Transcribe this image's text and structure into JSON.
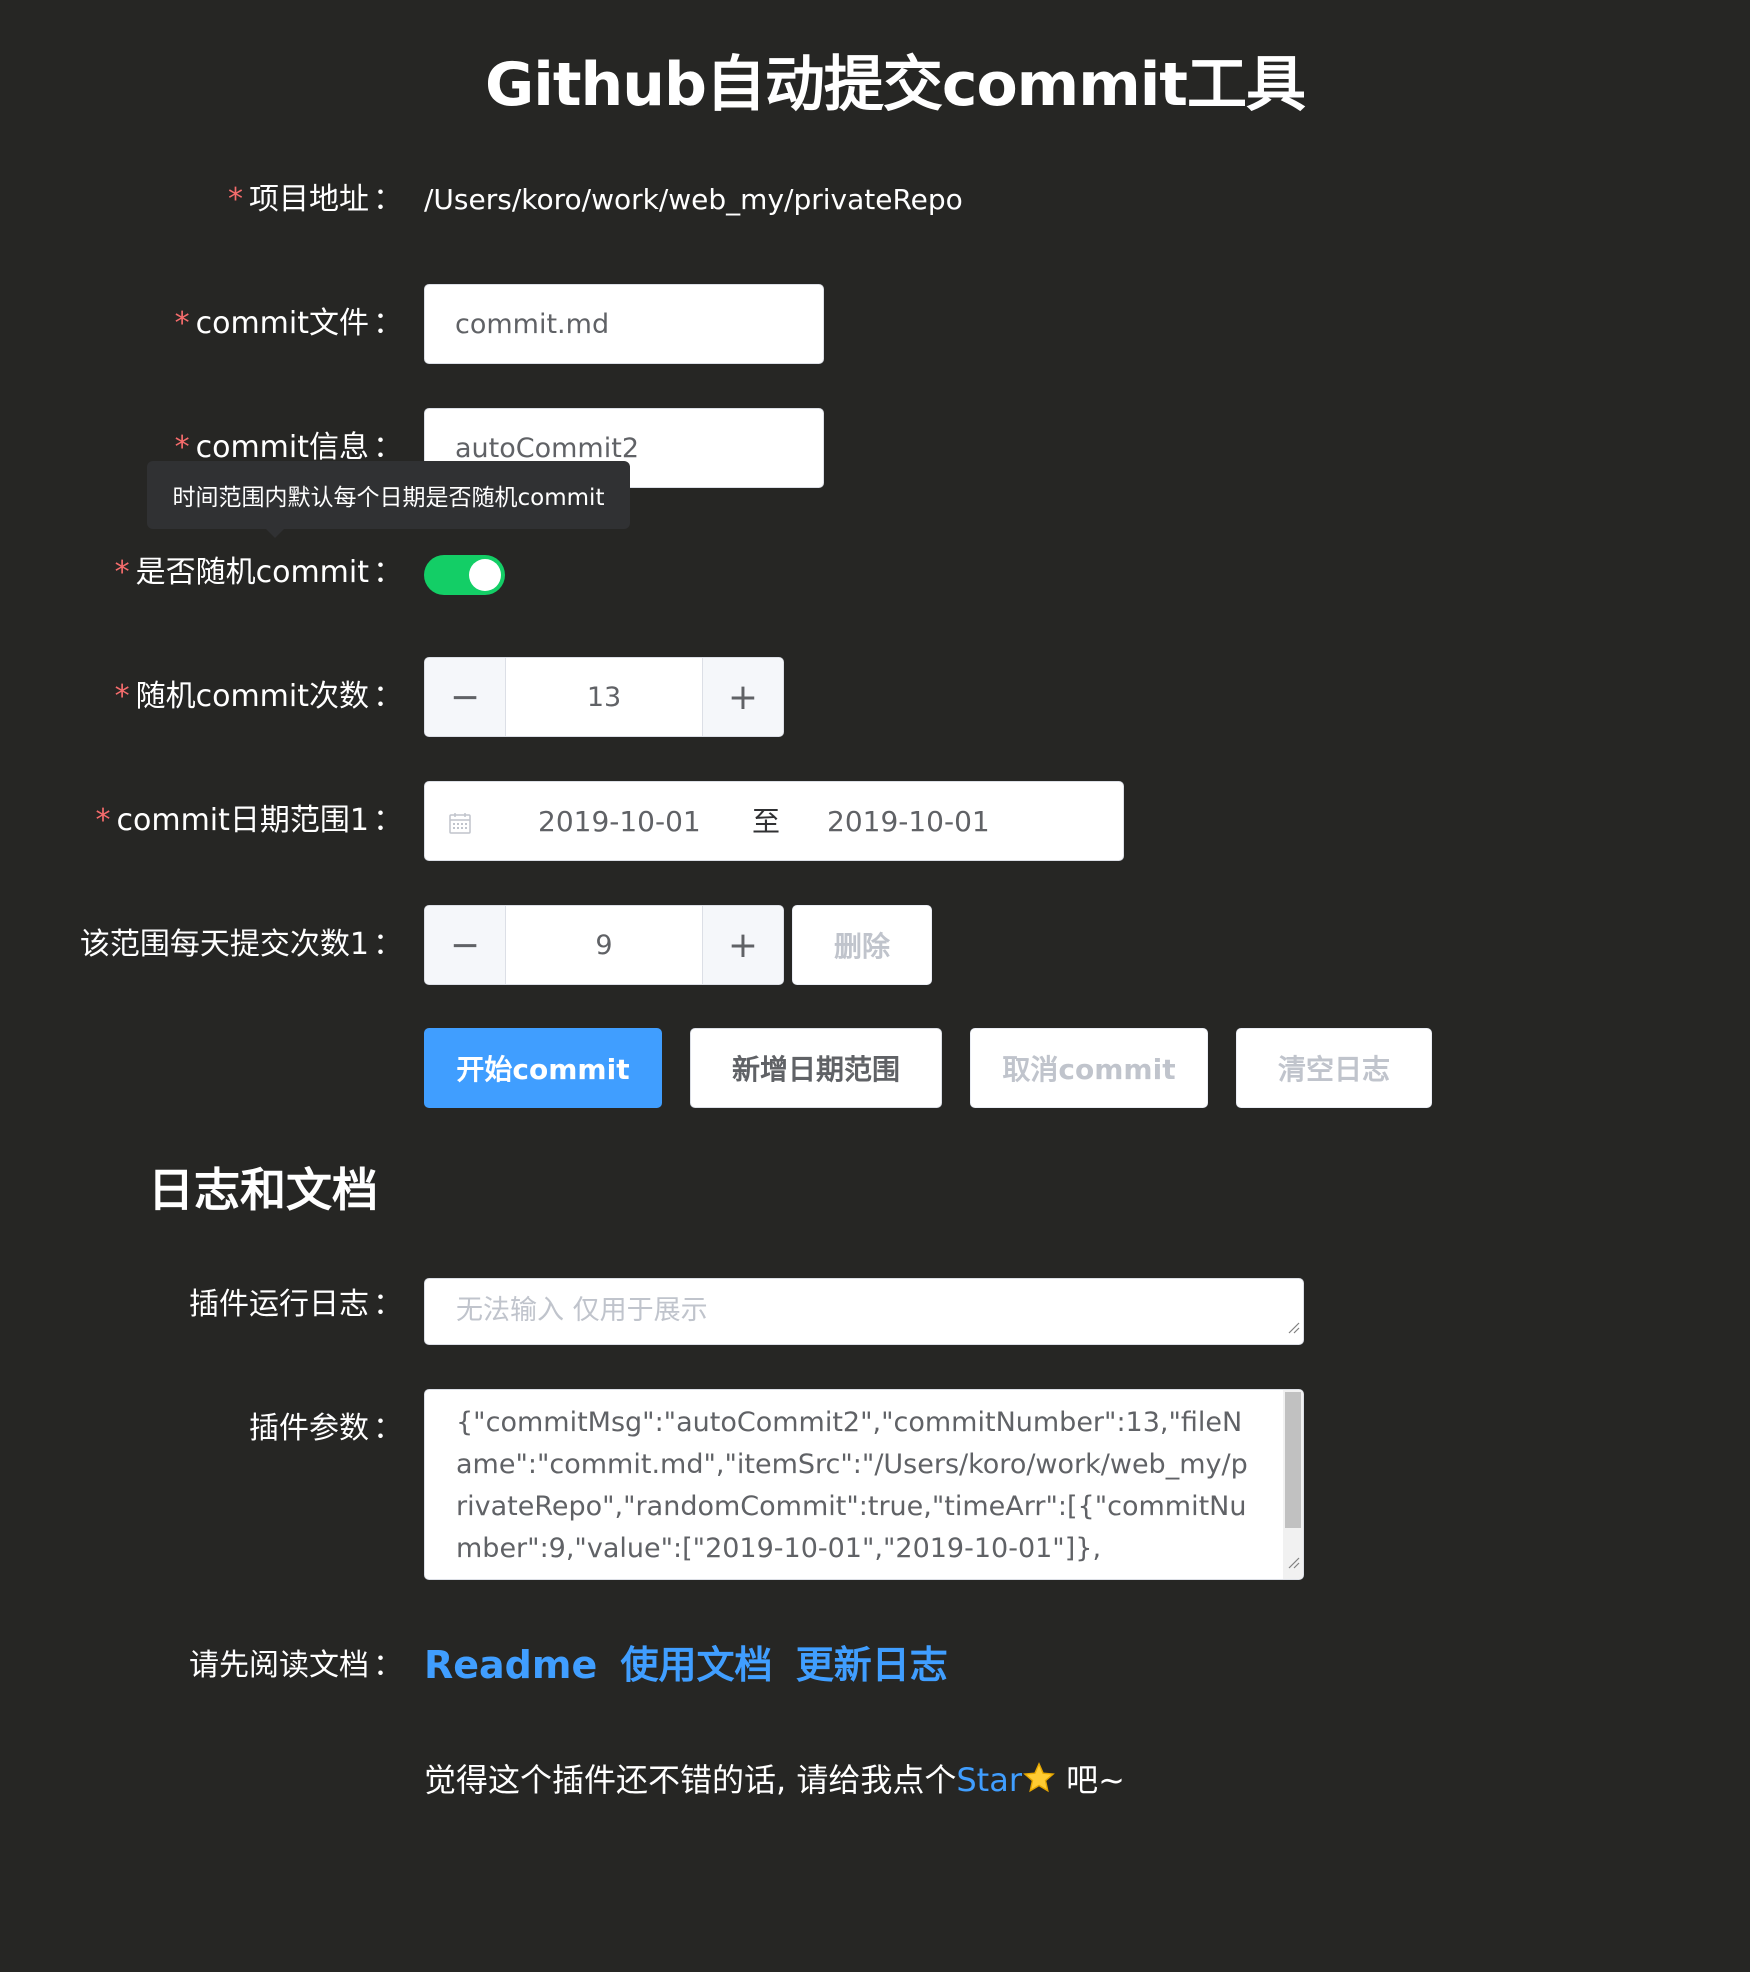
{
  "title": "Github自动提交commit工具",
  "form": {
    "item_src": {
      "label": "项目地址",
      "value": "/Users/koro/work/web_my/privateRepo"
    },
    "file_name": {
      "label": "commit文件",
      "value": "commit.md"
    },
    "commit_msg": {
      "label": "commit信息",
      "value": "autoCommit2"
    },
    "random_commit": {
      "label": "是否随机commit",
      "on": true,
      "tooltip": "时间范围内默认每个日期是否随机commit"
    },
    "random_count": {
      "label": "随机commit次数",
      "value": "13",
      "minus": "−",
      "plus": "+"
    },
    "date_range": {
      "label": "commit日期范围1",
      "start": "2019-10-01",
      "separator": "至",
      "end": "2019-10-01",
      "icon": "calendar-icon"
    },
    "daily_count": {
      "label": "该范围每天提交次数1",
      "value": "9",
      "minus": "−",
      "plus": "+",
      "delete_label": "删除"
    },
    "colon": "：",
    "required_mark": "*"
  },
  "actions": {
    "start": "开始commit",
    "add_range": "新增日期范围",
    "cancel": "取消commit",
    "clear_log": "清空日志"
  },
  "docs_section": {
    "title": "日志和文档",
    "log": {
      "label": "插件运行日志",
      "placeholder": "无法输入 仅用于展示"
    },
    "params": {
      "label": "插件参数",
      "value": "{\"commitMsg\":\"autoCommit2\",\"commitNumber\":13,\"fileName\":\"commit.md\",\"itemSrc\":\"/Users/koro/work/web_my/privateRepo\",\"randomCommit\":true,\"timeArr\":[{\"commitNumber\":9,\"value\":[\"2019-10-01\",\"2019-10-01\"]},"
    },
    "read_docs": {
      "label": "请先阅读文档",
      "links": [
        "Readme",
        "使用文档",
        "更新日志"
      ]
    },
    "star_line": {
      "before": "觉得这个插件还不错的话, 请给我点个",
      "star_link": "Star",
      "after": "吧~"
    }
  },
  "colors": {
    "background": "#262624",
    "primary": "#409eff",
    "switch_on": "#13ce66",
    "required": "#f56c6c"
  }
}
